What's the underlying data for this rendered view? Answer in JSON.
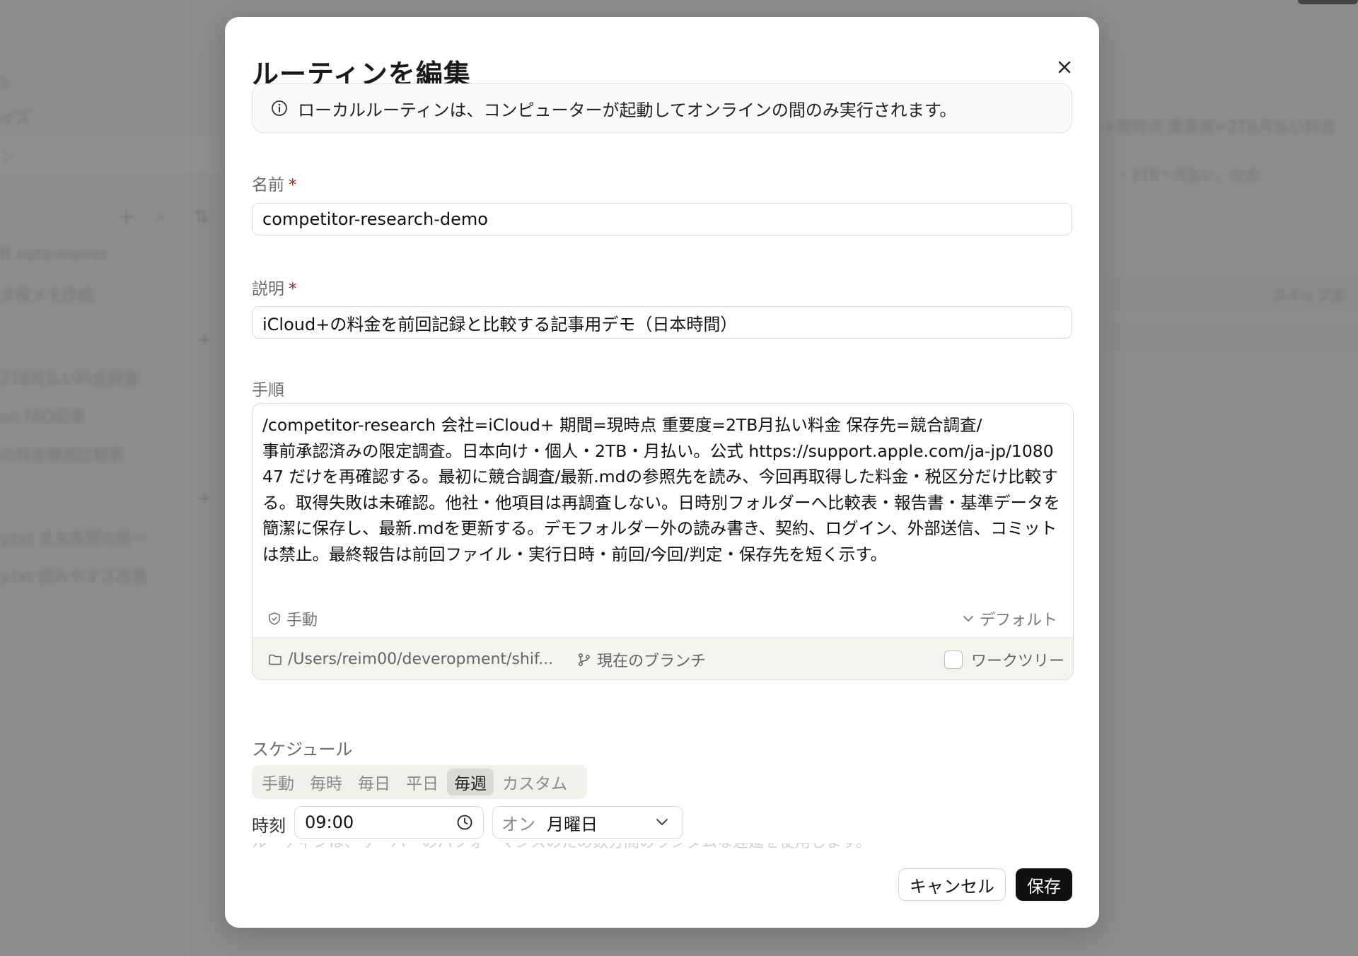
{
  "background": {
    "sidebar_items": [
      "s",
      "イズ",
      "ン",
      "ft neta-memo",
      "タ帳メモ作成",
      "2TB月払い料金調査",
      "on FAQ記事",
      "の料金機能比較表",
      "y.txt 文末表現の統一",
      "y.txt 読みやすさ改善"
    ],
    "right_header_text": "+現時点 重要度=2TB月払い料金",
    "right_sub_text": "・2TB・月払い。公式",
    "right_column_text": "スキップ済"
  },
  "dialog": {
    "title": "ルーティンを編集",
    "notice": "ローカルルーティンは、コンピューターが起動してオンラインの間のみ実行されます。",
    "name": {
      "label": "名前",
      "required_mark": "*",
      "value": "competitor-research-demo"
    },
    "description": {
      "label": "説明",
      "required_mark": "*",
      "value": "iCloud+の料金を前回記録と比較する記事用デモ（日本時間）"
    },
    "steps": {
      "label": "手順",
      "value": "/competitor-research 会社=iCloud+ 期間=現時点 重要度=2TB月払い料金 保存先=競合調査/\n事前承認済みの限定調査。日本向け・個人・2TB・月払い。公式 https://support.apple.com/ja-jp/108047 だけを再確認する。最初に競合調査/最新.mdの参照先を読み、今回再取得した料金・税区分だけ比較する。取得失敗は未確認。他社・他項目は再調査しない。日時別フォルダーへ比較表・報告書・基準データを簡潔に保存し、最新.mdを更新する。デモフォルダー外の読み書き、契約、ログイン、外部送信、コミットは禁止。最終報告は前回ファイル・実行日時・前回/今回/判定・保存先を短く示す。",
      "permission_label": "手動",
      "model_label": "デフォルト",
      "folder_path": "/Users/reim00/deveropment/shif...",
      "branch_label": "現在のブランチ",
      "worktree_label": "ワークツリー"
    },
    "schedule": {
      "label": "スケジュール",
      "options": [
        "手動",
        "毎時",
        "毎日",
        "平日",
        "毎週",
        "カスタム"
      ],
      "selected": "毎週",
      "time_label": "時刻",
      "time_value": "09:00",
      "day_prefix": "オン",
      "day_value": "月曜日",
      "note": "ルーティンは、サーバーのパフォーマンスのため数分間のランダムな遅延を使用します。"
    },
    "cancel_label": "キャンセル",
    "save_label": "保存"
  }
}
